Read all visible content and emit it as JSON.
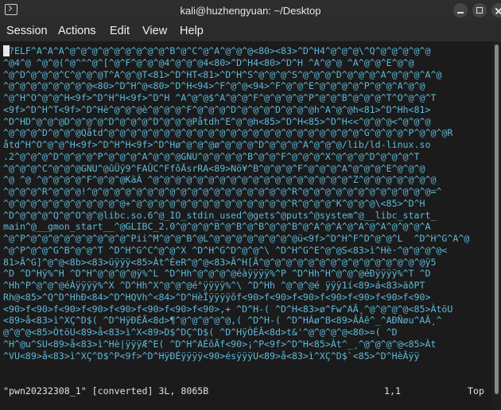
{
  "window": {
    "title": "kali@huzhengyuan: ~/Desktop"
  },
  "menu": [
    "Session",
    "Actions",
    "Edit",
    "View",
    "Help"
  ],
  "terminal": {
    "lines": [
      "^?ELF^A^A^A^@^@^@^@^@^@^@^@^@^B^@^C^@^A^@^@^@<80><83>^D^H4^@^@^@\\^Q^@^@^@^@^@",
      "^@4^@ ^@^@(^@^^^@^[^@^F^@^@^@4^@^@^@4<80>^D^H4<80>^D^H ^A^@^@ ^A^@^@^E^@^@",
      "^@^D^@^@^@^C^@^@^@T^A^@^@T<81>^D^HT<81>^D^H^S^@^@^@^S^@^@^@^D^@^@^@^A^@^@^@^A^@",
      "^@^@^@^@^@^@^@^@<80>^D^H^@<80>^D^H<94>^F^@^@<94>^F^@^@^E^@^@^@^@^P^@^@^A^@^@",
      "^@^H^O^@^@^H<9f>^D^H^H<9f>^D^H ^A^@^@$^A^@^@^F^@^@^@^@^P^@^@^B^@^@^@^T^O^@^@^T",
      "<9f>^D^H^T<9f>^D^Hè^@^@^@è^@^@^@^F^@^@^@^D^@^@^@^D^@^@^@h^A^@^@h<81>^D^Hh<81>",
      "^D^HD^@^@^@D^@^@^@^D^@^@^@^D^@^@^@Påtdh^E^@^@h<85>^D^H<85>^D^H<<^@^@^@<^@^@^@",
      "^@^@^@^D^@^@^@Qåtd^@^@^@^@^@^@^@^@^@^@^@^@^@^@^@^@^@^@^@^@^@^@^@^G^@^@^@^P^@^@^@R",
      "åtd^H^O^@^@^H<9f>^D^H^H<9f>^D^Hø^@^@^@ø^@^@^@^D^@^@^@^A^@^@^@/lib/ld-linux.so",
      ".2^@^@^@^D^@^@^@^P^@^@^@^A^@^@^@GNU^@^@^@^@^B^@^@^F^@^@^@^X^@^@^@^D^@^@^@^T",
      "^@^@^@^C^@^@^@GNU^@ûÜÿ9^FAÛC^FfôÃsrRA<89>Nö¥^B^@^@^@^F^@^@^@^A^@^@^@^E^@^@^@",
      "^@ ^@ ^@^@^@^@^F^@^@^@KäÀ ^@^@^@^@^@^@^@^@^@^@^@^@^@^@^@^@^@^@^Z^@^@^@^@^@^@^@",
      "^@^@^@^R^@^@^@!^@^@^@^@^@^@^@^@^@^@^@^@^@^@^@^@^@^@^R^@^@^@^@^@^@^@^@^@^@^@^@=^",
      "^@^@^@^@^@^@^@^@^@^@^@+^@^@^@^@^@^@^@^@^@^@^@^@^@^@^R^@^@^@^K^@^@^@\\<85>^D^H",
      "^D^@^@^@^Q^@^O^@^@libc.so.6^@_IO_stdin_used^@gets^@puts^@system^@__libc_start_",
      "main^@__gmon_start__^@GLIBC_2.0^@^@^@^B^@^B^@^B^@^@^B^@^A^@^A^@^A^@^A^@^@^@^A",
      "^@^P^@^@^@^@^@^@^@^@^@^Pii^M^@^@^B^@L^@^@^@^@^@^@^@^@ü<9f>^D^H^F^D^@^@^L  ^D^H^G^A^@",
      "^@^P^@^@^G^B^@^@^T ^D^H^G^C^@^@^X ^D^H^G^D^@^@^\\ ^D^H^G^E^@^@S<83>ì^Hè·^@^@^@^@<",
      "81>Ã^G]^@^@<8b><83>üÿÿÿ<85>Àt^ÈeR^@^@<83>Ä^H[Ã^@^@^@^@^@^@^@^@^@^@^@^@^@^@^@ÿ5",
      "^D ^D^Hÿ%^H ^D^H^@^@^@^@ÿ%^L ^D^Hh^@^@^@^@éàÿÿÿÿ%^P ^D^Hh^H^@^@^@éÐÿÿÿÿ%^T ^D",
      "^Hh^P^@^@^@éÀÿÿÿÿ%^X ^D^Hh^X^@^@^@é°ÿÿÿÿ%^\\ ^D^Hh ^@^@^@é ÿÿÿ1í<89>á<83>äðPT",
      "Rh@<85>^Q^D^HhÐ<84>^D^HQVh^<84>^D^HèÏÿÿÿÿôf<90>f<90>f<90>f<90>f<90>f<90>f<90>",
      "<90>f<90>f<90>f<90>f<90>f<90>f<90>f<90>,+ ^D^H-( ^D^H<83>ø^Fw^AÃ¸^@^@^@^@<85>ÀtöU",
      "<89>å<83>ì^XÇ^D$( ^D^HÿÐÉÃ<8d>¶^@^@^@^@^@,( ^D^H-( ^D^HÁø^B<89>ÂÁê^_^AÐÑøu^AÃ¸^",
      "@^@^@<85>ÒtöU<89>å<83>ì^X<89>D$^DÇ^D$( ^D^HÿÒÉÃ<8d>t&'^@^@^@^@<80>=( ^D",
      "^H^@u^SU<89>å<83>ì^Hè|ÿÿÿÆ^E( ^D^H^AÉôÃf<90>¡^P<9f>^D^H<85>Àt^_¸^@^@^@^@<85>Àt",
      "^VU<89>å<83>ì^XÇ^D$^P<9f>^D^HÿÐÉÿÿÿÿ<90>ésÿÿÿU<89>å<83>ì^XÇ^D$`<85>^D^HèÂÿÿ"
    ],
    "status": {
      "file_info": "\"pwn20232308_1\" [converted] 3L, 8065B",
      "cursor_position": "1,1",
      "scroll_position": "Top"
    }
  },
  "colors": {
    "text": "#5fb8d8",
    "background": "#1b1b1b",
    "titlebar": "#2d2d2d",
    "status_text": "#e0e0e0"
  },
  "icons": {
    "app": "terminal-icon",
    "minimize": "minimize-icon",
    "maximize": "maximize-icon",
    "close": "close-icon"
  }
}
